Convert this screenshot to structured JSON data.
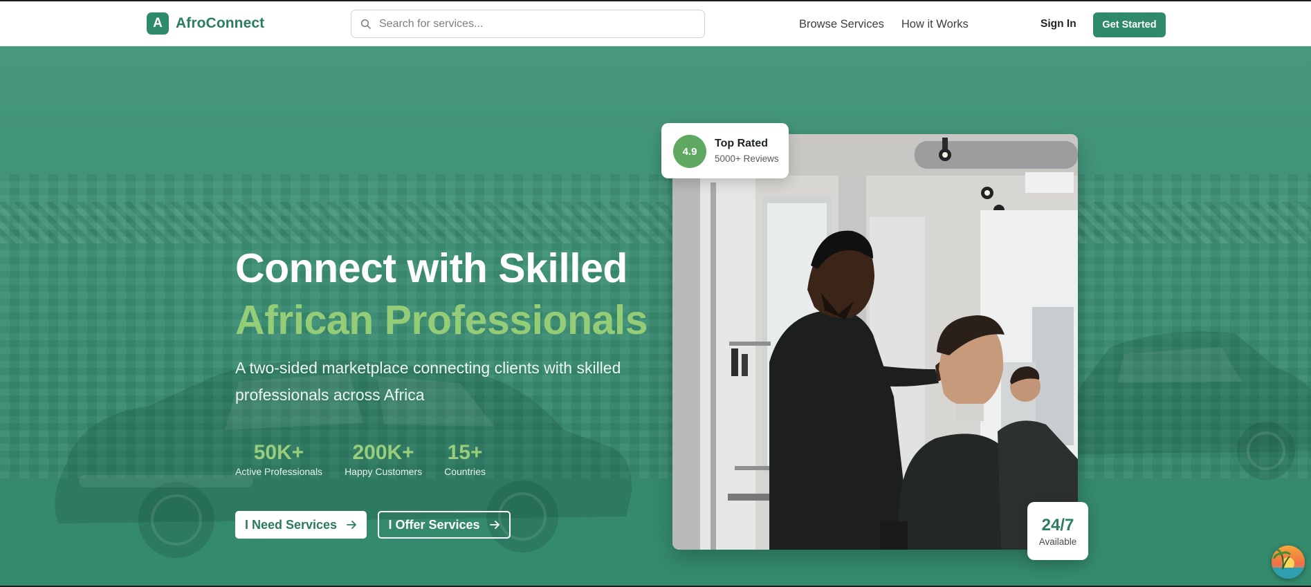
{
  "brand": {
    "logo_letter": "A",
    "name": "AfroConnect"
  },
  "search": {
    "placeholder": "Search for services..."
  },
  "nav": {
    "links": [
      "Browse Services",
      "How it Works"
    ],
    "sign_in": "Sign In",
    "get_started": "Get Started"
  },
  "hero": {
    "title_line1": "Connect with Skilled",
    "title_line2": "African Professionals",
    "subtitle": "A two-sided marketplace connecting clients with skilled professionals across Africa",
    "stats": [
      {
        "value": "50K+",
        "label": "Active Professionals"
      },
      {
        "value": "200K+",
        "label": "Happy Customers"
      },
      {
        "value": "15+",
        "label": "Countries"
      }
    ],
    "buttons": {
      "need": "I Need Services",
      "offer": "I Offer Services"
    }
  },
  "rating_card": {
    "score": "4.9",
    "title": "Top Rated",
    "subtitle": "5000+ Reviews"
  },
  "availability_card": {
    "value": "24/7",
    "label": "Available"
  },
  "colors": {
    "brand_green": "#2f8a6c",
    "accent_light_green": "#95cc78",
    "hero_background": "#3d9176"
  },
  "icons": [
    "search-icon",
    "arrow-right-icon",
    "floating-assistant-icon"
  ]
}
